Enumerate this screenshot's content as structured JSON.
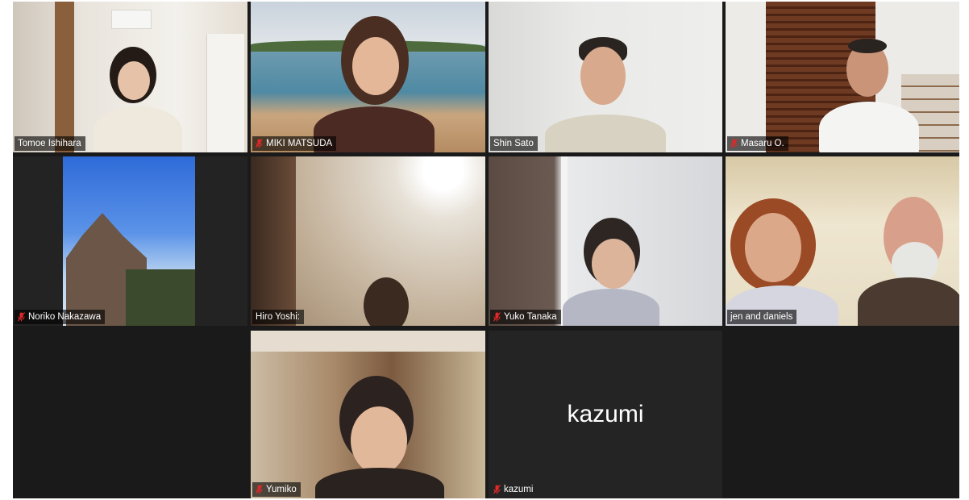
{
  "participants": [
    {
      "name": "Tomoe Ishihara",
      "muted": false,
      "active_speaker": true
    },
    {
      "name": "MIKI MATSUDA",
      "muted": true
    },
    {
      "name": "Shin Sato",
      "muted": false
    },
    {
      "name": "Masaru O.",
      "muted": true
    },
    {
      "name": "Noriko Nakazawa",
      "muted": true
    },
    {
      "name": "Hiro Yoshi:",
      "muted": false
    },
    {
      "name": "Yuko  Tanaka",
      "muted": true
    },
    {
      "name": "jen and daniels",
      "muted": false
    },
    {
      "name": "Yumiko",
      "muted": true
    },
    {
      "name": "kazumi",
      "muted": true,
      "video_off": true,
      "center_label": "kazumi"
    }
  ],
  "icons": {
    "muted": "mic-muted-icon"
  },
  "colors": {
    "active_border": "#23d959",
    "muted_icon": "#e02828",
    "background": "#1a1a1a"
  }
}
